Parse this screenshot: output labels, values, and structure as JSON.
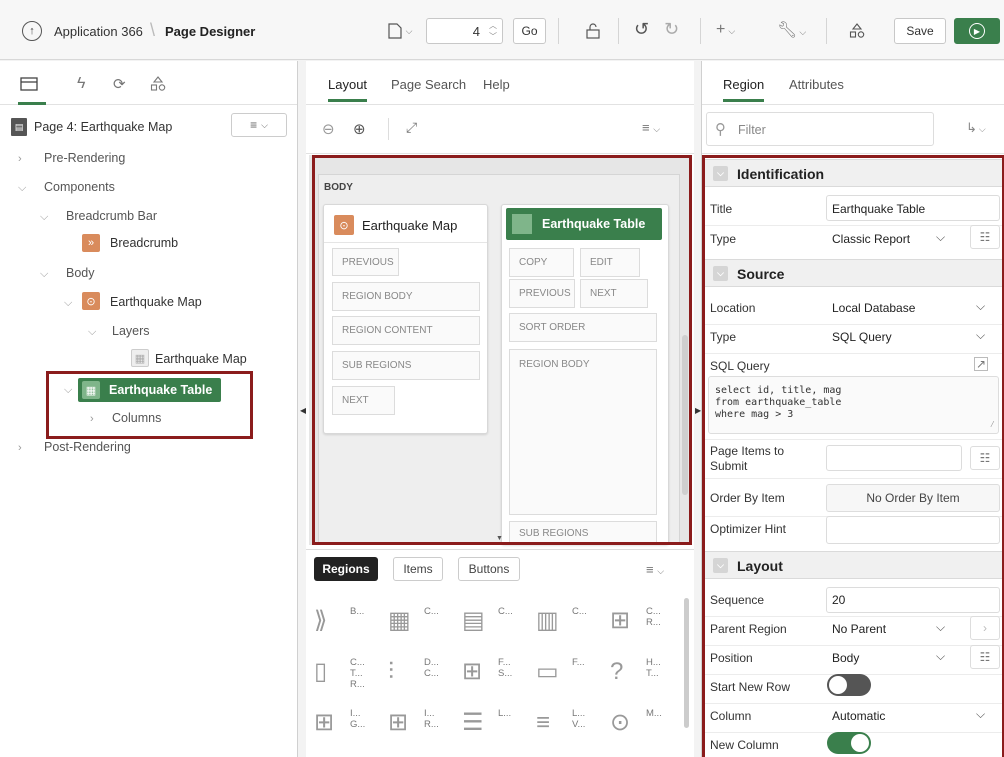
{
  "header": {
    "app_link": "Application 366",
    "page_title": "Page Designer",
    "page_number": "4",
    "go_label": "Go",
    "save_label": "Save"
  },
  "left": {
    "page_node": "Page 4: Earthquake Map",
    "tree": {
      "pre_rendering": "Pre-Rendering",
      "components": "Components",
      "breadcrumb_bar": "Breadcrumb Bar",
      "breadcrumb": "Breadcrumb",
      "body": "Body",
      "earthquake_map": "Earthquake Map",
      "layers": "Layers",
      "layer_earthquake_map": "Earthquake Map",
      "earthquake_table": "Earthquake Table",
      "columns": "Columns",
      "post_rendering": "Post-Rendering"
    }
  },
  "middle": {
    "tabs": [
      "Layout",
      "Page Search",
      "Help"
    ],
    "body_label": "BODY",
    "map_region": {
      "title": "Earthquake Map",
      "slots": [
        "PREVIOUS",
        "REGION BODY",
        "REGION CONTENT",
        "SUB REGIONS",
        "NEXT"
      ]
    },
    "table_region": {
      "title": "Earthquake Table",
      "copy": "COPY",
      "edit": "EDIT",
      "previous": "PREVIOUS",
      "next": "NEXT",
      "sort_order": "SORT ORDER",
      "region_body": "REGION BODY",
      "sub_regions": "SUB REGIONS"
    },
    "gallery": {
      "tabs": [
        "Regions",
        "Items",
        "Buttons"
      ],
      "items": [
        {
          "label": "B...",
          "icon": "breadcrumb-icon"
        },
        {
          "label": "C...",
          "icon": "calendar-icon"
        },
        {
          "label": "C...",
          "icon": "cards-icon"
        },
        {
          "label": "C...",
          "icon": "chart-icon"
        },
        {
          "label": "C... R...",
          "icon": "classic-report-icon"
        },
        {
          "label": "C... T... R...",
          "icon": "column-toggle-icon"
        },
        {
          "label": "D... C...",
          "icon": "dynamic-content-icon"
        },
        {
          "label": "F... S...",
          "icon": "faceted-search-icon"
        },
        {
          "label": "F...",
          "icon": "form-icon"
        },
        {
          "label": "H... T...",
          "icon": "help-text-icon"
        },
        {
          "label": "I... G...",
          "icon": "interactive-grid-icon"
        },
        {
          "label": "I... R...",
          "icon": "interactive-report-icon"
        },
        {
          "label": "L...",
          "icon": "list-icon"
        },
        {
          "label": "L... V...",
          "icon": "list-view-icon"
        },
        {
          "label": "M...",
          "icon": "map-icon"
        }
      ]
    }
  },
  "right": {
    "tabs": [
      "Region",
      "Attributes"
    ],
    "filter_placeholder": "Filter",
    "identification": {
      "heading": "Identification",
      "title_label": "Title",
      "title_value": "Earthquake Table",
      "type_label": "Type",
      "type_value": "Classic Report"
    },
    "source": {
      "heading": "Source",
      "location_label": "Location",
      "location_value": "Local Database",
      "type_label": "Type",
      "type_value": "SQL Query",
      "sql_label": "SQL Query",
      "sql_lines": [
        "select id, title, mag",
        "from earthquake_table",
        "where mag > 3"
      ],
      "page_items_label": "Page Items to Submit",
      "order_by_label": "Order By Item",
      "order_by_value": "No Order By Item",
      "optimizer_label": "Optimizer Hint"
    },
    "layout": {
      "heading": "Layout",
      "sequence_label": "Sequence",
      "sequence_value": "20",
      "parent_label": "Parent Region",
      "parent_value": "No Parent",
      "position_label": "Position",
      "position_value": "Body",
      "start_row_label": "Start New Row",
      "start_row_on": false,
      "column_label": "Column",
      "column_value": "Automatic",
      "new_column_label": "New Column",
      "new_column_on": true
    }
  },
  "colors": {
    "accent_green": "#3a7f4c",
    "highlight_red": "#8b1c1c",
    "map_orange": "#d98b5c"
  }
}
